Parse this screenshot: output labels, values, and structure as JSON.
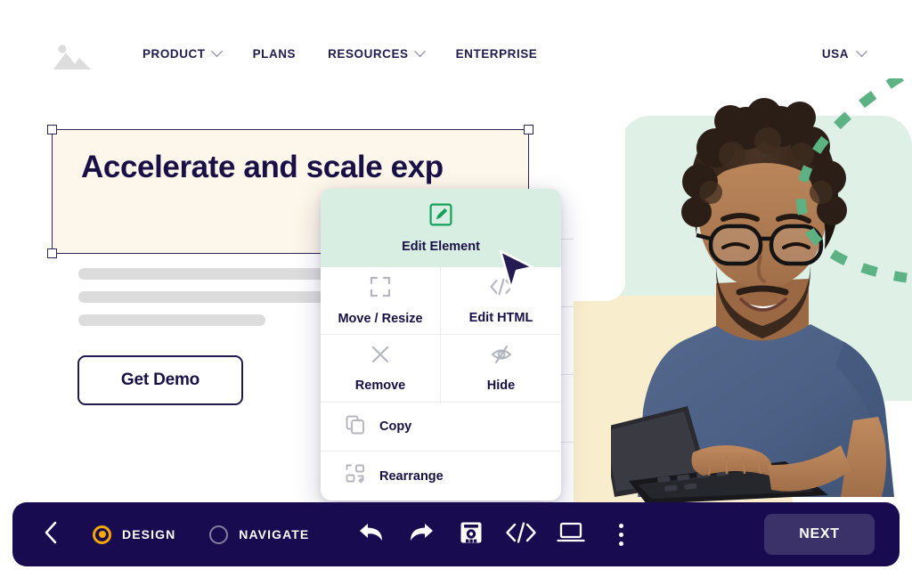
{
  "site_nav": {
    "logo_icon": "image-placeholder-icon",
    "links": [
      {
        "label": "PRODUCT",
        "has_dropdown": true
      },
      {
        "label": "PLANS",
        "has_dropdown": false
      },
      {
        "label": "RESOURCES",
        "has_dropdown": true
      },
      {
        "label": "ENTERPRISE",
        "has_dropdown": false
      }
    ],
    "locale": {
      "label": "USA",
      "icon": "chevron-down-icon"
    }
  },
  "hero": {
    "headline": "Accelerate and scale exp",
    "cta_label": "Get Demo",
    "selection": {
      "handles": 4,
      "border_color": "#2d2658",
      "fill_color": "#fdf6ea"
    },
    "skeleton_bars": 3,
    "visual": {
      "mint_shape_color": "#dff0e6",
      "cream_shape_color": "#f8edcd",
      "arc_color": "#5cb283",
      "dash_color": "#f2c14e",
      "photo_alt": "Smiling man with curly hair and glasses typing on a laptop"
    }
  },
  "context_menu": {
    "highlight_color": "#d9eee2",
    "primary": {
      "label": "Edit Element",
      "icon": "pencil-square-icon"
    },
    "grid": [
      {
        "label": "Move / Resize",
        "icon": "move-resize-icon"
      },
      {
        "label": "Edit HTML",
        "icon": "code-icon"
      },
      {
        "label": "Remove",
        "icon": "close-x-icon"
      },
      {
        "label": "Hide",
        "icon": "eye-slash-icon"
      }
    ],
    "rows": [
      {
        "label": "Copy",
        "icon": "copy-icon"
      },
      {
        "label": "Rearrange",
        "icon": "rearrange-icon"
      }
    ],
    "cursor": "mouse-pointer-cursor"
  },
  "toolbar": {
    "background": "#190b50",
    "back_icon": "chevron-left-icon",
    "modes": [
      {
        "label": "DESIGN",
        "selected": true,
        "accent": "#f5a800"
      },
      {
        "label": "NAVIGATE",
        "selected": false
      }
    ],
    "icons": [
      {
        "name": "undo-icon"
      },
      {
        "name": "redo-icon"
      },
      {
        "name": "save-icon"
      },
      {
        "name": "code-icon"
      },
      {
        "name": "desktop-icon"
      },
      {
        "name": "kebab-menu-icon"
      }
    ],
    "next_label": "NEXT",
    "next_color": "#3b3269"
  }
}
